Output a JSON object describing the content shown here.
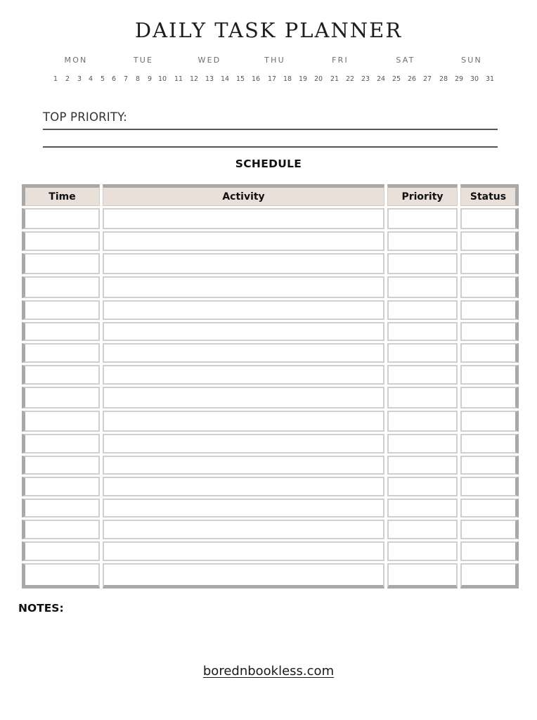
{
  "title": "DAILY TASK PLANNER",
  "weekdays": [
    "MON",
    "TUE",
    "WED",
    "THU",
    "FRI",
    "SAT",
    "SUN"
  ],
  "dates": [
    "1",
    "2",
    "3",
    "4",
    "5",
    "6",
    "7",
    "8",
    "9",
    "10",
    "11",
    "12",
    "13",
    "14",
    "15",
    "16",
    "17",
    "18",
    "19",
    "20",
    "21",
    "22",
    "23",
    "24",
    "25",
    "26",
    "27",
    "28",
    "29",
    "30",
    "31"
  ],
  "top_priority": {
    "label": "TOP PRIORITY:",
    "value": ""
  },
  "schedule": {
    "heading": "SCHEDULE",
    "columns": [
      "Time",
      "Activity",
      "Priority",
      "Status"
    ],
    "rows": [
      [
        "",
        "",
        "",
        ""
      ],
      [
        "",
        "",
        "",
        ""
      ],
      [
        "",
        "",
        "",
        ""
      ],
      [
        "",
        "",
        "",
        ""
      ],
      [
        "",
        "",
        "",
        ""
      ],
      [
        "",
        "",
        "",
        ""
      ],
      [
        "",
        "",
        "",
        ""
      ],
      [
        "",
        "",
        "",
        ""
      ],
      [
        "",
        "",
        "",
        ""
      ],
      [
        "",
        "",
        "",
        ""
      ],
      [
        "",
        "",
        "",
        ""
      ],
      [
        "",
        "",
        "",
        ""
      ],
      [
        "",
        "",
        "",
        ""
      ],
      [
        "",
        "",
        "",
        ""
      ],
      [
        "",
        "",
        "",
        ""
      ],
      [
        "",
        "",
        "",
        ""
      ],
      [
        "",
        "",
        "",
        ""
      ]
    ]
  },
  "notes": {
    "label": "NOTES:",
    "value": ""
  },
  "footer": {
    "link_text": "borednbookless.com"
  },
  "colors": {
    "header_fill": "#e8e0d9",
    "frame_gray": "#a8a8a8",
    "cell_border": "#cfcfcf"
  }
}
